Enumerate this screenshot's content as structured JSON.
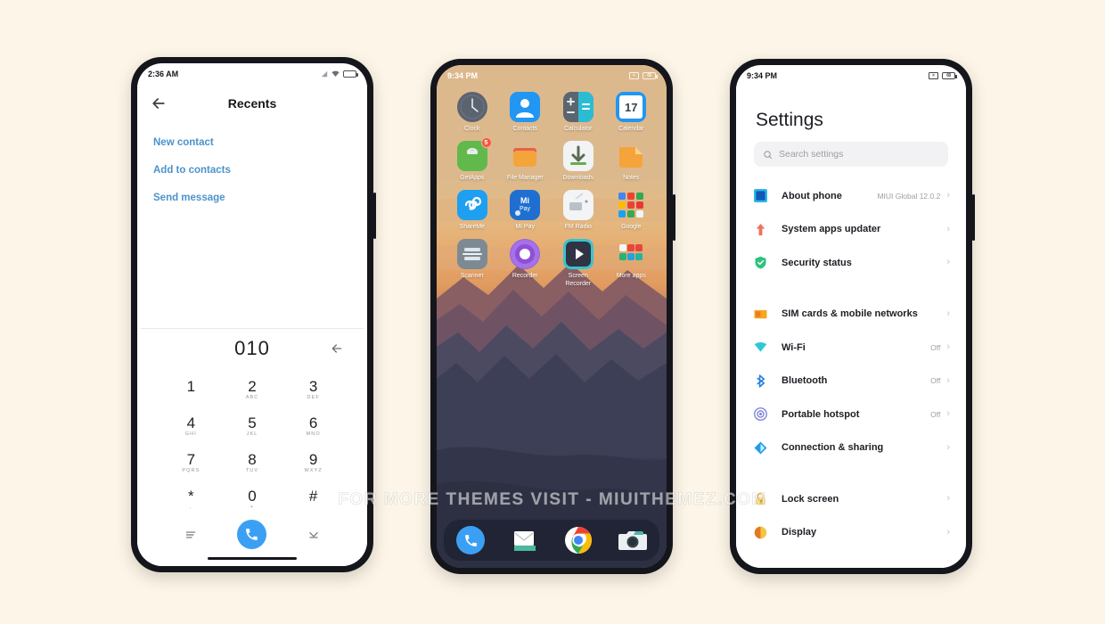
{
  "background_color": "#fdf6e8",
  "watermark": "FOR MORE THEMES VISIT - MIUITHEMEZ.COM",
  "phone1": {
    "status": {
      "time": "2:36 AM",
      "icons": [
        "signal-icon",
        "wifi-icon",
        "battery-icon"
      ]
    },
    "header": {
      "back_icon": "arrow-left-icon",
      "title": "Recents"
    },
    "actions": [
      "New contact",
      "Add to contacts",
      "Send message"
    ],
    "dial": {
      "number": "010",
      "delete_icon": "backspace-icon",
      "keys": [
        {
          "digit": "1",
          "letters": ""
        },
        {
          "digit": "2",
          "letters": "ABC"
        },
        {
          "digit": "3",
          "letters": "DEF"
        },
        {
          "digit": "4",
          "letters": "GHI"
        },
        {
          "digit": "5",
          "letters": "JKL"
        },
        {
          "digit": "6",
          "letters": "MNO"
        },
        {
          "digit": "7",
          "letters": "PQRS"
        },
        {
          "digit": "8",
          "letters": "TUV"
        },
        {
          "digit": "9",
          "letters": "WXYZ"
        },
        {
          "digit": "*",
          "letters": ","
        },
        {
          "digit": "0",
          "letters": "+"
        },
        {
          "digit": "#",
          "letters": ""
        }
      ],
      "left_icon": "menu-icon",
      "call_icon": "phone-icon",
      "right_icon": "collapse-icon"
    }
  },
  "phone2": {
    "status": {
      "time": "9:34 PM",
      "icons": [
        "mute-icon",
        "battery-percent-icon"
      ],
      "battery": "60"
    },
    "apps": [
      {
        "name": "Clock",
        "icon": "clock-icon"
      },
      {
        "name": "Contacts",
        "icon": "contacts-icon"
      },
      {
        "name": "Calculator",
        "icon": "calculator-icon"
      },
      {
        "name": "Calendar",
        "icon": "calendar-icon",
        "day": "17"
      },
      {
        "name": "GetApps",
        "icon": "getapps-icon",
        "badge": "5"
      },
      {
        "name": "File Manager",
        "icon": "file-manager-icon"
      },
      {
        "name": "Downloads",
        "icon": "downloads-icon"
      },
      {
        "name": "Notes",
        "icon": "notes-icon"
      },
      {
        "name": "ShareMe",
        "icon": "shareme-icon"
      },
      {
        "name": "Mi Pay",
        "icon": "mipay-icon"
      },
      {
        "name": "FM Radio",
        "icon": "fm-radio-icon"
      },
      {
        "name": "Google",
        "icon": "google-folder-icon"
      },
      {
        "name": "Scanner",
        "icon": "scanner-icon"
      },
      {
        "name": "Recorder",
        "icon": "recorder-icon"
      },
      {
        "name": "Screen\nRecorder",
        "icon": "screen-recorder-icon"
      },
      {
        "name": "More apps",
        "icon": "more-apps-folder-icon"
      }
    ],
    "dock": [
      {
        "name": "Phone",
        "icon": "dock-phone-icon"
      },
      {
        "name": "Messages",
        "icon": "dock-messages-icon"
      },
      {
        "name": "Chrome",
        "icon": "dock-chrome-icon"
      },
      {
        "name": "Camera",
        "icon": "dock-camera-icon"
      }
    ]
  },
  "phone3": {
    "status": {
      "time": "9:34 PM",
      "icons": [
        "mute-icon",
        "battery-percent-icon"
      ],
      "battery": "60"
    },
    "title": "Settings",
    "search": {
      "placeholder": "Search settings",
      "icon": "search-icon"
    },
    "groups": [
      {
        "items": [
          {
            "label": "About phone",
            "value": "MIUI Global 12.0.2",
            "icon": "about-phone-icon",
            "color": "#1f6fd0"
          },
          {
            "label": "System apps updater",
            "value": "",
            "icon": "updater-icon",
            "color": "#f26b5b"
          },
          {
            "label": "Security status",
            "value": "",
            "icon": "security-icon",
            "color": "#2ec27e"
          }
        ]
      },
      {
        "items": [
          {
            "label": "SIM cards & mobile networks",
            "value": "",
            "icon": "sim-card-icon",
            "color": "#f5a623"
          },
          {
            "label": "Wi-Fi",
            "value": "Off",
            "icon": "wifi-settings-icon",
            "color": "#2ec9d6"
          },
          {
            "label": "Bluetooth",
            "value": "Off",
            "icon": "bluetooth-icon",
            "color": "#2a7fe0"
          },
          {
            "label": "Portable hotspot",
            "value": "Off",
            "icon": "hotspot-icon",
            "color": "#7b7fd4"
          },
          {
            "label": "Connection & sharing",
            "value": "",
            "icon": "connection-share-icon",
            "color": "#1d9cf0"
          }
        ]
      },
      {
        "items": [
          {
            "label": "Lock screen",
            "value": "",
            "icon": "lock-icon",
            "color": "#f5c542"
          },
          {
            "label": "Display",
            "value": "",
            "icon": "display-icon",
            "color": "#f5b942"
          }
        ]
      }
    ],
    "chevron": "›"
  }
}
